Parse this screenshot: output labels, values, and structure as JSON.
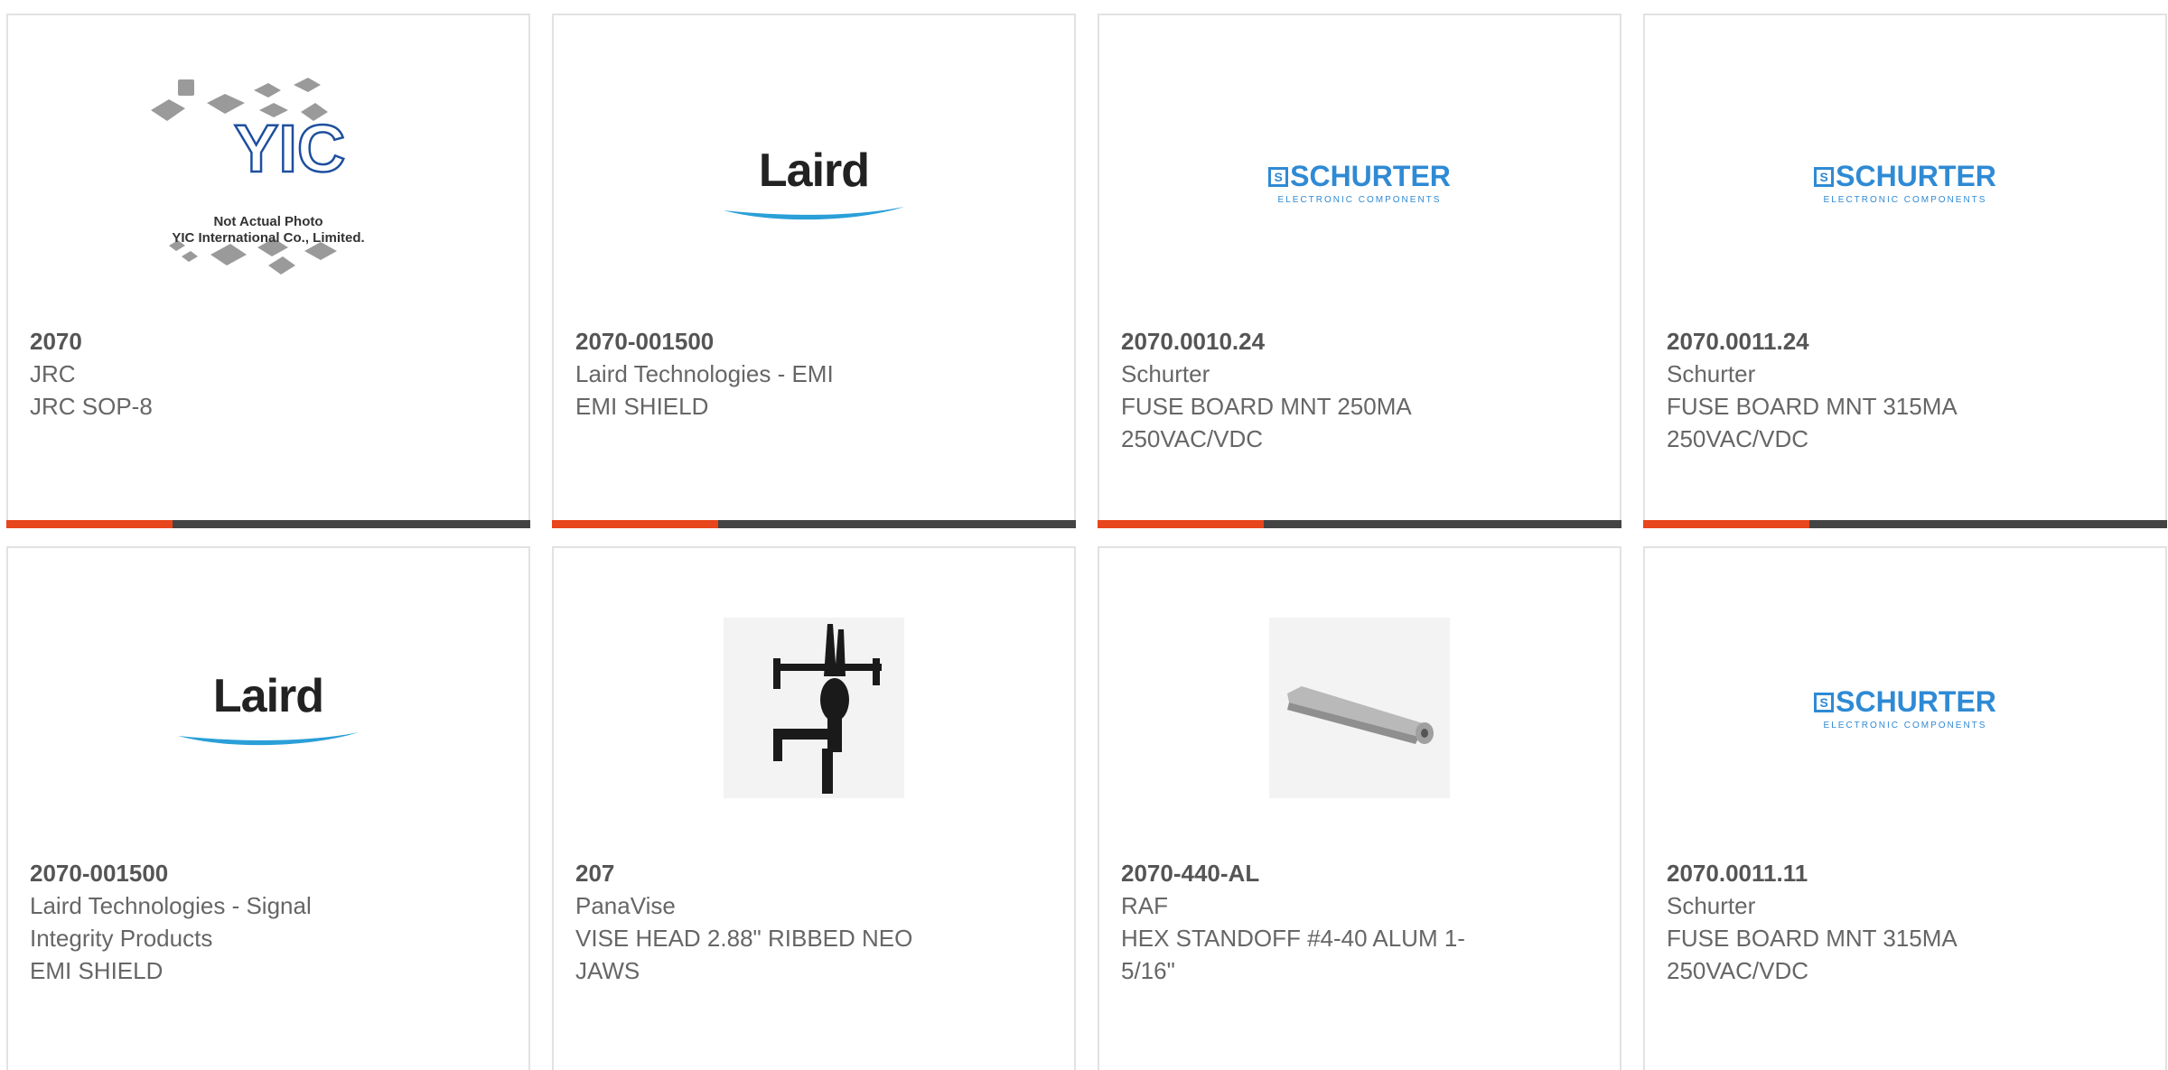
{
  "products": [
    {
      "part_number": "2070",
      "manufacturer": "JRC",
      "description": "JRC SOP-8",
      "image_icon": "yic-placeholder",
      "caption_line1": "Not Actual Photo",
      "caption_line2": "YIC International Co., Limited.",
      "logo_text": "YIC"
    },
    {
      "part_number": "2070-001500",
      "manufacturer": "Laird Technologies - EMI",
      "description": "EMI SHIELD",
      "image_icon": "laird-logo",
      "logo_text": "Laird"
    },
    {
      "part_number": "2070.0010.24",
      "manufacturer": "Schurter",
      "description": "FUSE BOARD MNT 250MA 250VAC/VDC",
      "image_icon": "schurter-logo",
      "logo_text": "SCHURTER",
      "logo_sub": "ELECTRONIC COMPONENTS"
    },
    {
      "part_number": "2070.0011.24",
      "manufacturer": "Schurter",
      "description": "FUSE BOARD MNT 315MA 250VAC/VDC",
      "image_icon": "schurter-logo",
      "logo_text": "SCHURTER",
      "logo_sub": "ELECTRONIC COMPONENTS"
    },
    {
      "part_number": "2070-001500",
      "manufacturer": "Laird Technologies - Signal Integrity Products",
      "description": "EMI SHIELD",
      "image_icon": "laird-logo",
      "logo_text": "Laird"
    },
    {
      "part_number": "207",
      "manufacturer": "PanaVise",
      "description": "VISE HEAD 2.88\" RIBBED NEO JAWS",
      "image_icon": "vise-head-photo"
    },
    {
      "part_number": "2070-440-AL",
      "manufacturer": "RAF",
      "description": "HEX STANDOFF #4-40 ALUM 1-5/16\"",
      "image_icon": "hex-standoff-photo"
    },
    {
      "part_number": "2070.0011.11",
      "manufacturer": "Schurter",
      "description": "FUSE BOARD MNT 315MA 250VAC/VDC",
      "image_icon": "schurter-logo",
      "logo_text": "SCHURTER",
      "logo_sub": "ELECTRONIC COMPONENTS"
    }
  ],
  "colors": {
    "accent": "#e8461c",
    "bar": "#444444",
    "border": "#e2e2e2",
    "schurter_blue": "#2f8ad4",
    "laird_swoosh": "#2a9fd8"
  }
}
